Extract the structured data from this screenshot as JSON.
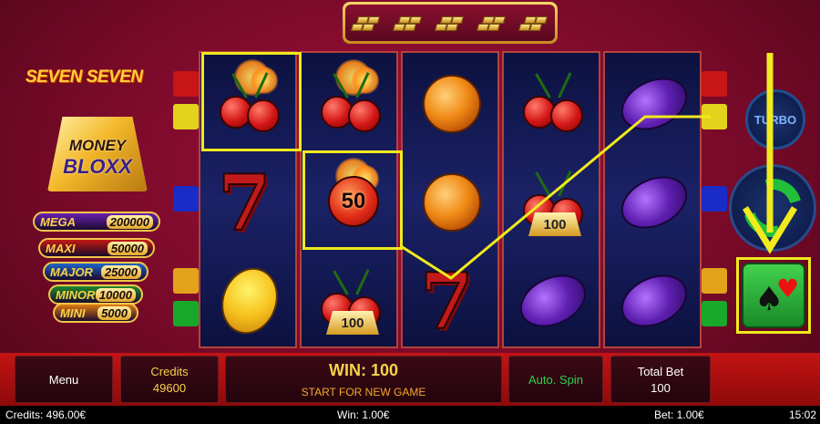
{
  "logo": {
    "seven_seven": "SEVEN SEVEN",
    "money": "MONEY",
    "bloxx": "BLOXX"
  },
  "jackpots": [
    {
      "name": "MEGA",
      "value": "200000",
      "color": "#6a1fb0"
    },
    {
      "name": "MAXI",
      "value": "50000",
      "color": "#c31a12"
    },
    {
      "name": "MAJOR",
      "value": "25000",
      "color": "#1f64c8"
    },
    {
      "name": "MINOR",
      "value": "10000",
      "color": "#1f8a2a"
    },
    {
      "name": "MINI",
      "value": "5000",
      "color": "#e07a12"
    }
  ],
  "reels": [
    [
      "fire-cherry",
      "seven",
      "lemon"
    ],
    [
      "fire-cherry",
      "fire-cherry-50",
      "cherry-100"
    ],
    [
      "orange",
      "orange",
      "seven"
    ],
    [
      "cherry",
      "cherry-100",
      "plum"
    ],
    [
      "plum",
      "plum",
      "plum"
    ]
  ],
  "symbol_values": {
    "fifty": "50",
    "hundred": "100"
  },
  "buttons": {
    "turbo": "TURBO"
  },
  "panel": {
    "menu": "Menu",
    "credits_label": "Credits",
    "credits_value": "49600",
    "win": "WIN: 100",
    "win_hint": "START FOR NEW GAME",
    "auto_spin": "Auto. Spin",
    "total_bet_label": "Total Bet",
    "total_bet_value": "100"
  },
  "status": {
    "credits": "Credits: 496.00€",
    "win": "Win: 1.00€",
    "bet": "Bet: 1.00€",
    "time": "15:02"
  },
  "colors": {
    "highlight": "#f0ea1e",
    "gold": "#f6d34a",
    "spin_green": "#22c03a"
  }
}
